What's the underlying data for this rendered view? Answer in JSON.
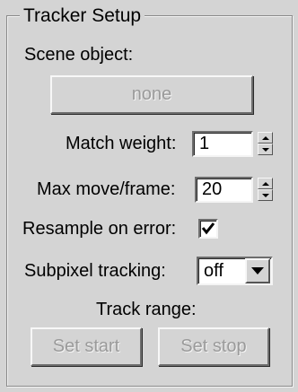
{
  "panel": {
    "title": "Tracker Setup",
    "scene_object_label": "Scene object:",
    "scene_object_button": "none",
    "match_weight_label": "Match weight:",
    "match_weight_value": "1",
    "max_move_label": "Max move/frame:",
    "max_move_value": "20",
    "resample_label": "Resample on error:",
    "resample_checked": true,
    "subpixel_label": "Subpixel tracking:",
    "subpixel_value": "off",
    "track_range_label": "Track range:",
    "set_start_label": "Set start",
    "set_stop_label": "Set stop"
  },
  "icons": {
    "spinner_up": "triangle-up",
    "spinner_down": "triangle-down",
    "dropdown": "triangle-down",
    "checkmark": "check"
  }
}
